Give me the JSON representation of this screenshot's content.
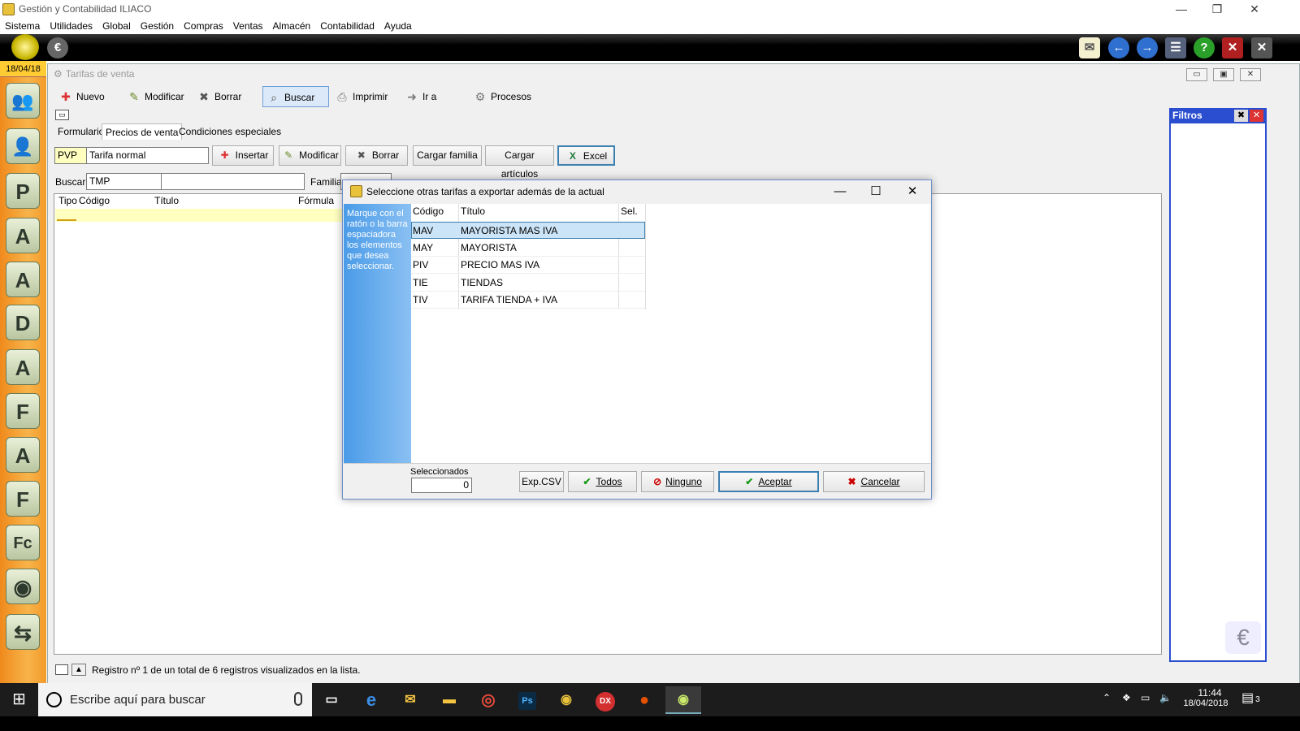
{
  "window": {
    "title": "Gestión y Contabilidad ILIACO",
    "minimize": "—",
    "restore": "❐",
    "close": "✕"
  },
  "menu": [
    "Sistema",
    "Utilidades",
    "Global",
    "Gestión",
    "Compras",
    "Ventas",
    "Almacén",
    "Contabilidad",
    "Ayuda"
  ],
  "sidebar": {
    "date": "18/04/18",
    "icons": [
      "users-icon",
      "user-icon",
      "user-p-icon",
      "user-a-icon",
      "box-a-icon",
      "letter-d-icon",
      "letter-a-icon",
      "letter-f-icon",
      "letter-a-icon",
      "letter-f-icon",
      "letter-fc-icon",
      "magic-disc-icon",
      "transfer-icon"
    ],
    "glyphs": [
      "👥",
      "👤",
      "P",
      "A",
      "A",
      "D",
      "A",
      "F",
      "A",
      "F",
      "Fc",
      "◉",
      "⇆"
    ]
  },
  "main": {
    "title": "Tarifas de venta",
    "toolbar": [
      "Nuevo",
      "Modificar",
      "Borrar",
      "Buscar",
      "Imprimir",
      "Ir a",
      "Procesos"
    ],
    "tabs": [
      "Formulario",
      "Precios de venta",
      "Condiciones especiales"
    ],
    "tarifa_code": "PVP",
    "tarifa_name": "Tarifa normal",
    "actions": [
      "Insertar",
      "Modificar",
      "Borrar",
      "Cargar familia",
      "Cargar artículos",
      "Excel"
    ],
    "buscar_label": "Buscar:",
    "buscar_value": "TMP",
    "familia_label": "Familia:",
    "grid_headers": [
      "Tipo",
      "Código",
      "Título",
      "Fórmula"
    ],
    "status": "Registro nº 1 de un total de 6 registros visualizados en la lista."
  },
  "filtros": {
    "title": "Filtros"
  },
  "dialog": {
    "title": "Seleccione otras tarifas a exportar además de la actual",
    "instructions": "Marque con el ratón o la barra espaciadora los elementos que desea seleccionar.",
    "headers": [
      "Código",
      "Título",
      "Sel."
    ],
    "rows": [
      {
        "code": "MAV",
        "title": "MAYORISTA MAS IVA"
      },
      {
        "code": "MAY",
        "title": "MAYORISTA"
      },
      {
        "code": "PIV",
        "title": "PRECIO MAS IVA"
      },
      {
        "code": "TIE",
        "title": "TIENDAS"
      },
      {
        "code": "TIV",
        "title": "TARIFA TIENDA + IVA"
      }
    ],
    "selected_label": "Seleccionados",
    "selected_count": "0",
    "buttons": {
      "exp_csv": "Exp.CSV",
      "todos": "Todos",
      "ninguno": "Ninguno",
      "aceptar": "Aceptar",
      "cancelar": "Cancelar"
    }
  },
  "taskbar": {
    "search_placeholder": "Escribe aquí para buscar",
    "time": "11:44",
    "date": "18/04/2018",
    "notifications": "3",
    "apps": [
      "task-view-icon",
      "edge-icon",
      "mail-app-icon",
      "file-explorer-icon",
      "chrome-icon",
      "photoshop-icon",
      "iliaco-app-icon",
      "dx-app-icon",
      "firebird-icon",
      "iliaco-active-icon"
    ],
    "app_glyphs": [
      "▭",
      "e",
      "✉",
      "▬",
      "◎",
      "Ps",
      "◉",
      "DX",
      "●",
      "◉"
    ]
  }
}
